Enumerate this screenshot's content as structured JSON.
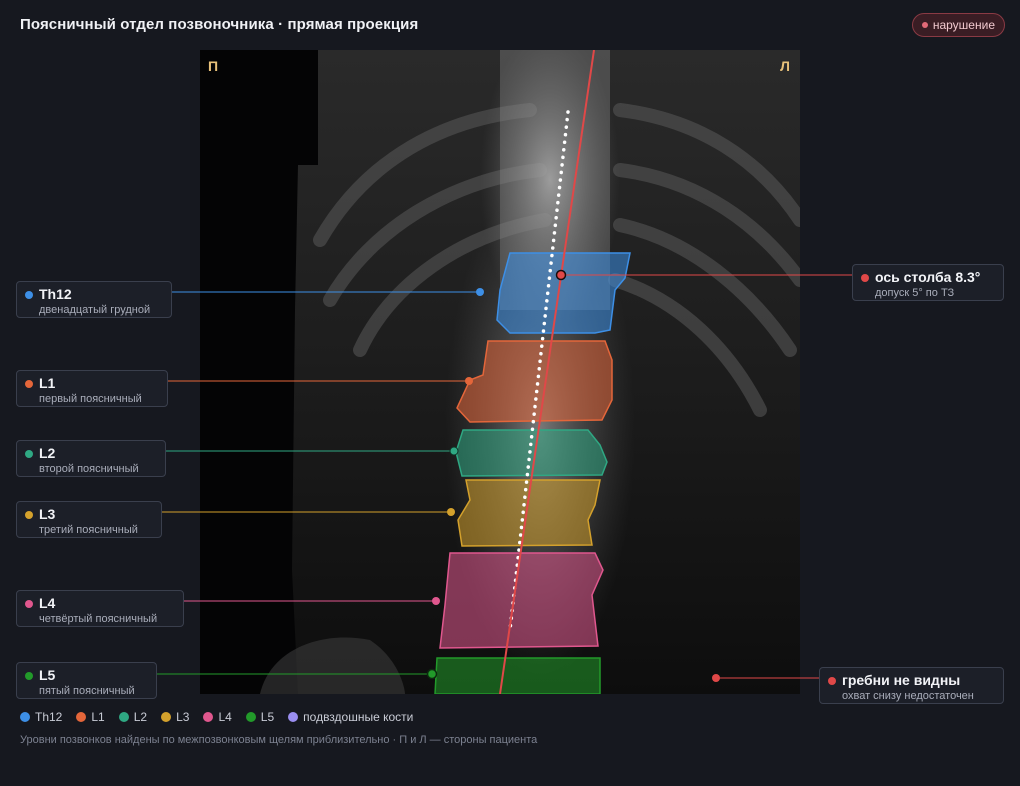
{
  "header": {
    "title": "Поясничный отдел позвоночника · прямая проекция",
    "status_badge": "нарушение"
  },
  "scan": {
    "side_right": "П",
    "side_left": "Л"
  },
  "vertebrae": [
    {
      "id": "th12",
      "name": "Th12",
      "sub": "двенадцатый грудной",
      "color": "#3d8fe6"
    },
    {
      "id": "l1",
      "name": "L1",
      "sub": "первый поясничный",
      "color": "#e4663a"
    },
    {
      "id": "l2",
      "name": "L2",
      "sub": "второй поясничный",
      "color": "#2fa883"
    },
    {
      "id": "l3",
      "name": "L3",
      "sub": "третий поясничный",
      "color": "#d4a12c"
    },
    {
      "id": "l4",
      "name": "L4",
      "sub": "четвёртый поясничный",
      "color": "#e0578e"
    },
    {
      "id": "l5",
      "name": "L5",
      "sub": "пятый поясничный",
      "color": "#229a2a"
    }
  ],
  "callouts": {
    "axis": {
      "title": "ось столба 8.3°",
      "sub": "допуск 5° по ТЗ",
      "color": "#e04848"
    },
    "crests": {
      "title": "гребни не видны",
      "sub": "охват снизу недостаточен",
      "color": "#e04848"
    }
  },
  "legend": [
    {
      "label": "Th12",
      "color": "#3d8fe6"
    },
    {
      "label": "L1",
      "color": "#e4663a"
    },
    {
      "label": "L2",
      "color": "#2fa883"
    },
    {
      "label": "L3",
      "color": "#d4a12c"
    },
    {
      "label": "L4",
      "color": "#e0578e"
    },
    {
      "label": "L5",
      "color": "#229a2a"
    },
    {
      "label": "подвздошные кости",
      "color": "#9a8ef0"
    }
  ],
  "footnote": "Уровни позвонков найдены по межпозвонковым щелям приблизительно · П и Л — стороны пациента"
}
